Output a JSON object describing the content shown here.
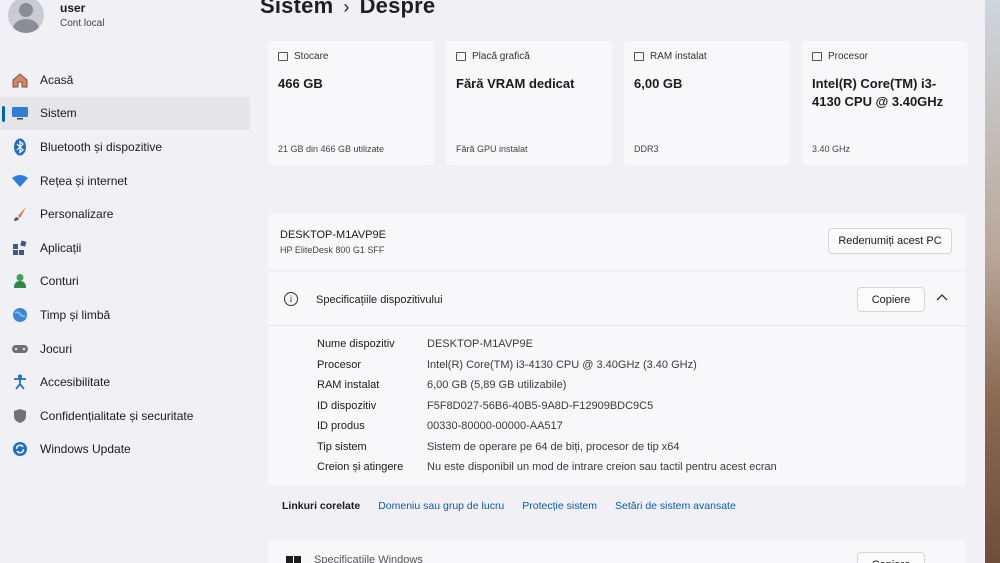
{
  "user": {
    "name": "user",
    "subtitle": "Cont local"
  },
  "sidebar": {
    "items": [
      {
        "label": "Acasă",
        "icon": "home-icon"
      },
      {
        "label": "Sistem",
        "icon": "system-icon",
        "active": true
      },
      {
        "label": "Bluetooth și dispozitive",
        "icon": "bluetooth-icon"
      },
      {
        "label": "Rețea și internet",
        "icon": "network-icon"
      },
      {
        "label": "Personalizare",
        "icon": "brush-icon"
      },
      {
        "label": "Aplicații",
        "icon": "apps-icon"
      },
      {
        "label": "Conturi",
        "icon": "accounts-icon"
      },
      {
        "label": "Timp și limbă",
        "icon": "globe-icon"
      },
      {
        "label": "Jocuri",
        "icon": "gamepad-icon"
      },
      {
        "label": "Accesibilitate",
        "icon": "accessibility-icon"
      },
      {
        "label": "Confidențialitate și securitate",
        "icon": "shield-icon"
      },
      {
        "label": "Windows Update",
        "icon": "update-icon"
      }
    ]
  },
  "breadcrumb": {
    "parent": "Sistem",
    "separator": "›",
    "current": "Despre"
  },
  "cards": [
    {
      "title": "Stocare",
      "value": "466 GB",
      "sub": "21 GB din 466 GB utilizate",
      "icon": "storage-icon"
    },
    {
      "title": "Placă grafică",
      "value": "Fără VRAM dedicat",
      "sub": "Fără GPU instalat",
      "icon": "gpu-icon"
    },
    {
      "title": "RAM instalat",
      "value": "6,00 GB",
      "sub": "DDR3",
      "icon": "ram-icon"
    },
    {
      "title": "Procesor",
      "value": "Intel(R) Core(TM) i3-4130 CPU @ 3.40GHz",
      "sub": "3.40 GHz",
      "icon": "cpu-icon"
    }
  ],
  "pc": {
    "name": "DESKTOP-M1AVP9E",
    "model": "HP EliteDesk 800 G1 SFF",
    "rename_label": "Redenumiți acest PC"
  },
  "specs": {
    "title": "Specificațiile dispozitivului",
    "copy_label": "Copiere",
    "rows": [
      {
        "label": "Nume dispozitiv",
        "value": "DESKTOP-M1AVP9E"
      },
      {
        "label": "Procesor",
        "value": "Intel(R) Core(TM) i3-4130 CPU @ 3.40GHz (3.40 GHz)"
      },
      {
        "label": "RAM instalat",
        "value": "6,00 GB (5,89 GB utilizabile)"
      },
      {
        "label": "ID dispozitiv",
        "value": "F5F8D027-56B6-40B5-9A8D-F12909BDC9C5"
      },
      {
        "label": "ID produs",
        "value": "00330-80000-00000-AA517"
      },
      {
        "label": "Tip sistem",
        "value": "Sistem de operare pe 64 de biți, procesor de tip x64"
      },
      {
        "label": "Creion și atingere",
        "value": "Nu este disponibil un mod de intrare creion sau tactil pentru acest ecran"
      }
    ]
  },
  "related": {
    "label": "Linkuri corelate",
    "links": [
      "Domeniu sau grup de lucru",
      "Protecție sistem",
      "Setări de sistem avansate"
    ]
  },
  "next_card": {
    "partial_text": "Specificațiile Windows",
    "copy_label": "Copiere"
  },
  "colors": {
    "accent": "#0063b1",
    "link": "#0b5cab",
    "background": "#f1f0f4",
    "card": "#f8f8fa"
  }
}
